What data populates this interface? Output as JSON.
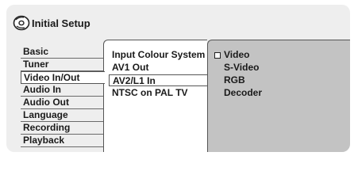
{
  "header": {
    "title": "Initial Setup",
    "icon": "disc-icon"
  },
  "categories": [
    {
      "label": "Basic",
      "active": false
    },
    {
      "label": "Tuner",
      "active": false
    },
    {
      "label": "Video In/Out",
      "active": true
    },
    {
      "label": "Audio In",
      "active": false
    },
    {
      "label": "Audio Out",
      "active": false
    },
    {
      "label": "Language",
      "active": false
    },
    {
      "label": "Recording",
      "active": false
    },
    {
      "label": "Playback",
      "active": false
    }
  ],
  "settings": [
    {
      "label": "Input Colour System",
      "active": false
    },
    {
      "label": "AV1 Out",
      "active": false
    },
    {
      "label": "AV2/L1 In",
      "active": true
    },
    {
      "label": "NTSC on PAL TV",
      "active": false
    }
  ],
  "options": [
    {
      "label": "Video",
      "selected": true
    },
    {
      "label": "S-Video",
      "selected": false
    },
    {
      "label": "RGB",
      "selected": false
    },
    {
      "label": "Decoder",
      "selected": false
    }
  ]
}
